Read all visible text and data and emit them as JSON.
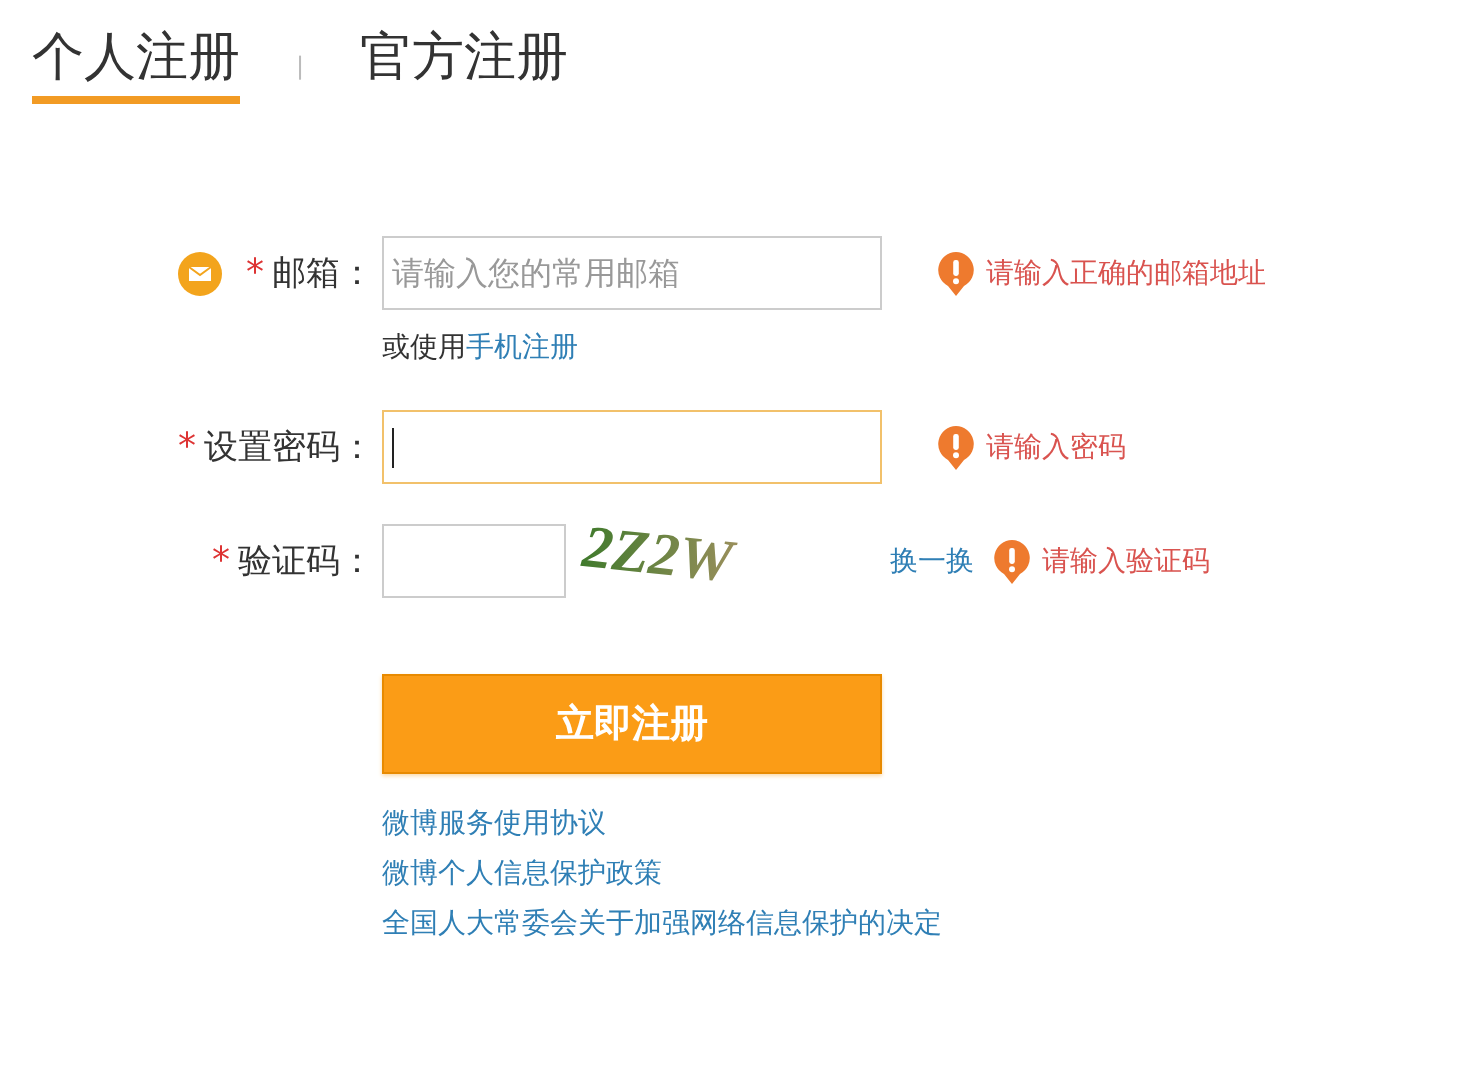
{
  "tabs": [
    {
      "label": "个人注册",
      "selected": true
    },
    {
      "label": "官方注册",
      "selected": false
    }
  ],
  "separator": "|",
  "form": {
    "rows": [
      {
        "kind": "email",
        "mark": "*",
        "label": "邮箱：",
        "placeholder": "请输入您的常用邮箱",
        "focused": false,
        "error": "请输入正确的邮箱地址"
      },
      {
        "kind": "password",
        "mark": "*",
        "label": "设置密码：",
        "focused": true,
        "error": "请输入密码"
      },
      {
        "kind": "captcha",
        "mark": "*",
        "label": "验证码：",
        "focused": false,
        "captcha": "2Z2W",
        "refresh": "换一换",
        "error": "请输入验证码"
      }
    ],
    "alt_text": "或使用",
    "alt_link": "手机注册",
    "submit": "立即注册",
    "links": [
      "微博服务使用协议",
      "微博个人信息保护政策",
      "全国人大常委会关于加强网络信息保护的决定"
    ]
  }
}
